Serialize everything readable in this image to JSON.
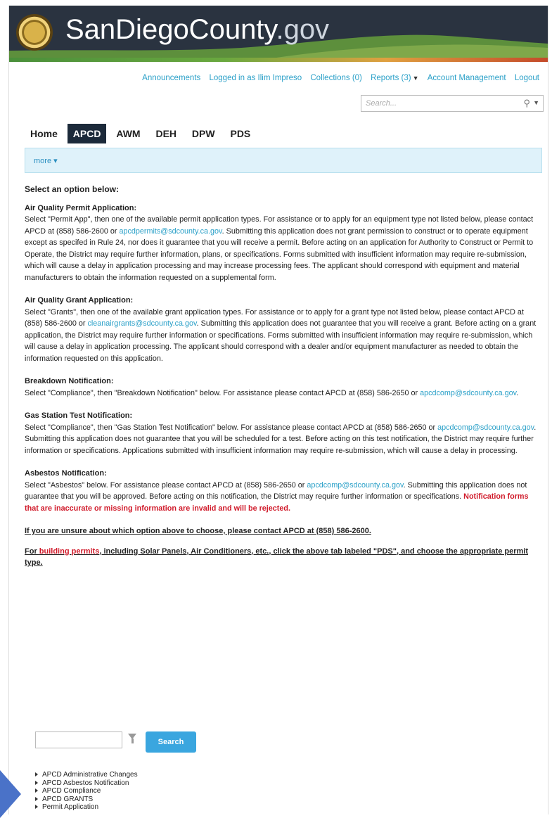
{
  "header": {
    "brand_main": "SanDiegoCounty",
    "brand_suffix": ".gov"
  },
  "toplinks": {
    "announcements": "Announcements",
    "logged_in": "Logged in as Ilim Impreso",
    "collections": "Collections (0)",
    "reports": "Reports (3)",
    "account": "Account Management",
    "logout": "Logout"
  },
  "search": {
    "placeholder": "Search..."
  },
  "tabs": [
    "Home",
    "APCD",
    "AWM",
    "DEH",
    "DPW",
    "PDS"
  ],
  "active_tab": "APCD",
  "subnav": {
    "more": "more ▾"
  },
  "content": {
    "heading": "Select an option below:",
    "sections": [
      {
        "title": "Air Quality Permit Application:",
        "pre": "Select \"Permit App\", then one of the available permit application types. For assistance or to apply for an equipment type not listed below, please contact APCD at (858) 586-2600 or ",
        "link": "apcdpermits@sdcounty.ca.gov",
        "post": ". Submitting this application does not grant permission to construct or to operate equipment except as specifed in Rule 24, nor does it guarantee that you will receive a permit. Before acting on an application for Authority to Construct or Permit to Operate, the District may require further information, plans, or specifications. Forms submitted with insufficient information may require re-submission, which will cause a delay in application processing and may increase processing fees. The applicant should correspond with equipment and material manufacturers to obtain the information requested on a supplemental form."
      },
      {
        "title": "Air Quality Grant Application:",
        "pre": "Select \"Grants\", then one of the available grant application types. For assistance or to apply for a grant type not listed below, please contact APCD at (858) 586-2600 or ",
        "link": "cleanairgrants@sdcounty.ca.gov",
        "post": ". Submitting this application does not guarantee that you will receive a grant. Before acting on a grant application, the District may require further information or specifications. Forms submitted with insufficient information may require re-submission, which will cause a delay in application processing. The applicant should correspond with a dealer and/or equipment manufacturer as needed to obtain the information requested on this application."
      },
      {
        "title": "Breakdown Notification:",
        "pre": "Select \"Compliance\", then \"Breakdown Notification\" below. For assistance please contact APCD at (858) 586-2650 or ",
        "link": "apcdcomp@sdcounty.ca.gov",
        "post": "."
      },
      {
        "title": "Gas Station Test Notification:",
        "pre": "Select \"Compliance\", then \"Gas Station Test Notification\" below. For assistance please contact APCD at (858) 586-2650 or ",
        "link": "apcdcomp@sdcounty.ca.gov",
        "post": ". Submitting this application does not guarantee that you will be scheduled for a test. Before acting on this test notification, the District may require further information or specifications. Applications submitted with insufficient information may require re-submission, which will cause a delay in processing."
      },
      {
        "title": "Asbestos Notification:",
        "pre": "Select \"Asbestos\" below. For assistance please contact APCD at (858) 586-2650 or ",
        "link": "apcdcomp@sdcounty.ca.gov",
        "post": ". Submitting this application does not guarantee that you will be approved. Before acting on this notification, the District may require further information or specifications. ",
        "red": "Notification forms that are inaccurate or missing information are invalid and will be rejected."
      }
    ],
    "unsure_note": "If you are unsure about which option above to choose, please contact APCD at (858) 586-2600.",
    "building_pre": "For ",
    "building_red": "building permits",
    "building_post": ", including Solar Panels, Air Conditioners, etc., click the above tab labeled \"PDS\", and choose the appropriate permit type."
  },
  "filter": {
    "search_label": "Search"
  },
  "tree": [
    "APCD Administrative Changes",
    "APCD Asbestos Notification",
    "APCD Compliance",
    "APCD GRANTS",
    "Permit Application"
  ],
  "colors": {
    "accent": "#2aa0c8",
    "banner": "#2a3340",
    "active_tab": "#1c2a3a",
    "warning": "#d01a2a",
    "button": "#3aa6df"
  }
}
